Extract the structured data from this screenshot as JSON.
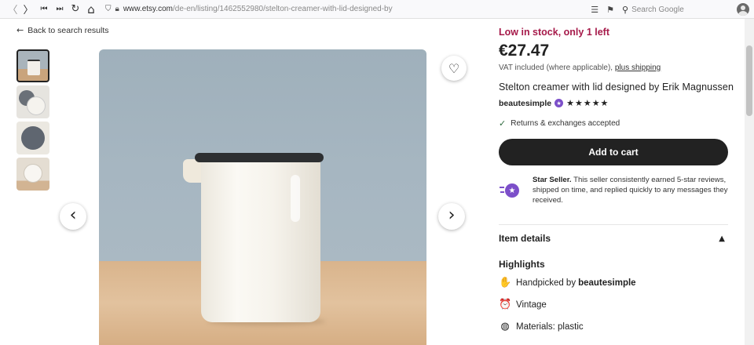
{
  "browser": {
    "url_host": "www.etsy.com",
    "url_path": "/de-en/listing/1462552980/stelton-creamer-with-lid-designed-by",
    "search_placeholder": "Search Google",
    "back_glyph": "〈",
    "forward_glyph": "〉",
    "first_glyph": "⏮",
    "last_glyph": "⏭",
    "reload_glyph": "↻",
    "home_glyph": "⌂"
  },
  "page": {
    "back_link": "Back to search results",
    "stock_notice": "Low in stock, only 1 left",
    "price": "€27.47",
    "vat_text": "VAT included (where applicable),",
    "shipping_link": "plus shipping",
    "title": "Stelton creamer with lid designed by Erik Magnussen",
    "seller_name": "beautesimple",
    "rating_stars": "★★★★★",
    "rating_value": 5,
    "returns": "Returns & exchanges accepted",
    "add_to_cart": "Add to cart",
    "star_seller_label": "Star Seller.",
    "star_seller_text": "This seller consistently earned 5-star reviews, shipped on time, and replied quickly to any messages they received.",
    "item_details": "Item details",
    "highlights_heading": "Highlights",
    "highlights": [
      {
        "label": "Handpicked by",
        "value": "beautesimple",
        "icon": "hand-icon"
      },
      {
        "label": "Vintage",
        "value": "",
        "icon": "alarm-clock-icon"
      },
      {
        "label": "Materials: plastic",
        "value": "",
        "icon": "materials-icon"
      }
    ]
  },
  "icons": {
    "prev": "‹",
    "next": "›",
    "heart": "♡",
    "check": "✓",
    "chevron_up": "⌃",
    "arrow_left": "←"
  },
  "colors": {
    "stock": "#a61a4a",
    "cart_button": "#222222",
    "star_seller": "#7c4fc9"
  }
}
